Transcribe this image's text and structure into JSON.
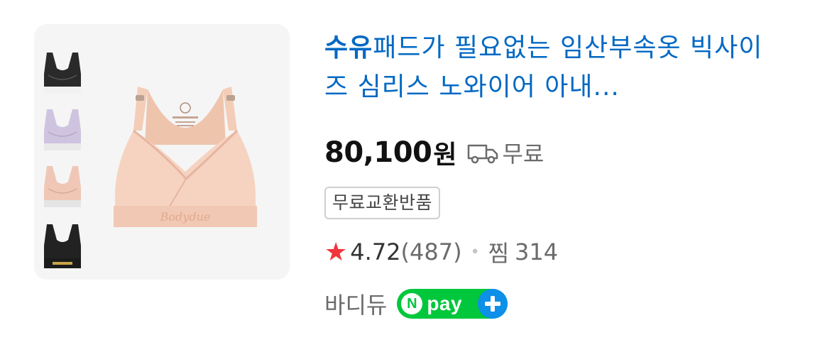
{
  "product": {
    "title_highlight": "수유",
    "title_rest": "패드가 필요없는 임산부속옷 빅사이즈 심리스 노와이어 아내...",
    "price": "80,100",
    "price_unit": "원",
    "shipping": "무료",
    "badge": "무료교환반품",
    "rating": "4.72",
    "review_count": "(487)",
    "zzim_label": "찜",
    "zzim_count": "314",
    "seller": "바디듀",
    "npay": {
      "n": "N",
      "pay": "pay"
    },
    "image_brand_text": "Bodydue"
  },
  "colors": {
    "title": "#0068c3",
    "star": "#f0343a",
    "npay_green": "#00c73c",
    "npay_blue": "#0e8fe8"
  },
  "icons": [
    "truck-icon",
    "star-icon",
    "plus-icon"
  ]
}
